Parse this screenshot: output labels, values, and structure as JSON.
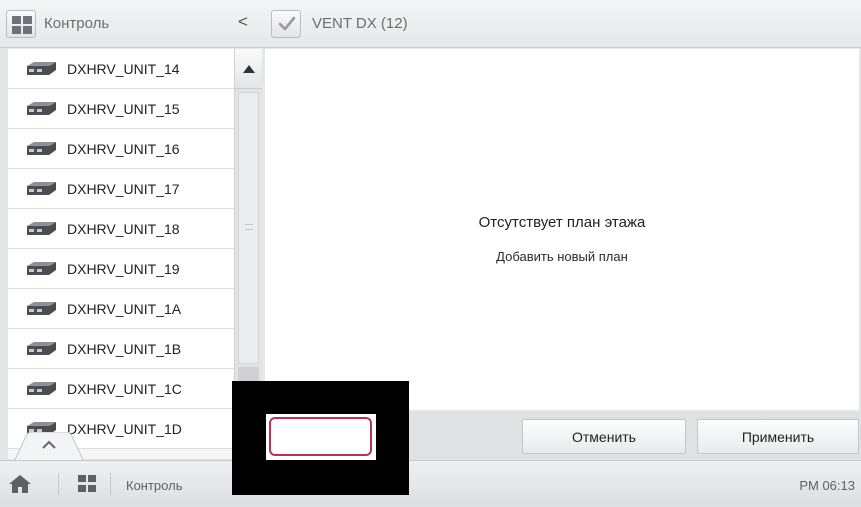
{
  "header": {
    "section_title": "Контроль",
    "collapse_glyph": "<",
    "view_title": "VENT DX (12)"
  },
  "units": [
    {
      "label": "DXHRV_UNIT_14",
      "icon": "hrv-unit-icon"
    },
    {
      "label": "DXHRV_UNIT_15",
      "icon": "hrv-unit-icon"
    },
    {
      "label": "DXHRV_UNIT_16",
      "icon": "hrv-unit-icon"
    },
    {
      "label": "DXHRV_UNIT_17",
      "icon": "hrv-unit-icon"
    },
    {
      "label": "DXHRV_UNIT_18",
      "icon": "hrv-unit-icon"
    },
    {
      "label": "DXHRV_UNIT_19",
      "icon": "hrv-unit-icon"
    },
    {
      "label": "DXHRV_UNIT_1A",
      "icon": "hrv-unit-icon"
    },
    {
      "label": "DXHRV_UNIT_1B",
      "icon": "hrv-unit-icon"
    },
    {
      "label": "DXHRV_UNIT_1C",
      "icon": "hrv-unit-icon"
    },
    {
      "label": "DXHRV_UNIT_1D",
      "icon": "hrv-unit-icon"
    }
  ],
  "main": {
    "empty_message": "Отсутствует план этажа",
    "add_plan_link": "Добавить новый план"
  },
  "actions": {
    "cancel_label": "Отменить",
    "apply_label": "Применить"
  },
  "footer": {
    "breadcrumb": "Контроль",
    "time": "PM 06:13"
  },
  "colors": {
    "highlight_border": "#b2345a",
    "accent_check": "#9a9a9a"
  }
}
